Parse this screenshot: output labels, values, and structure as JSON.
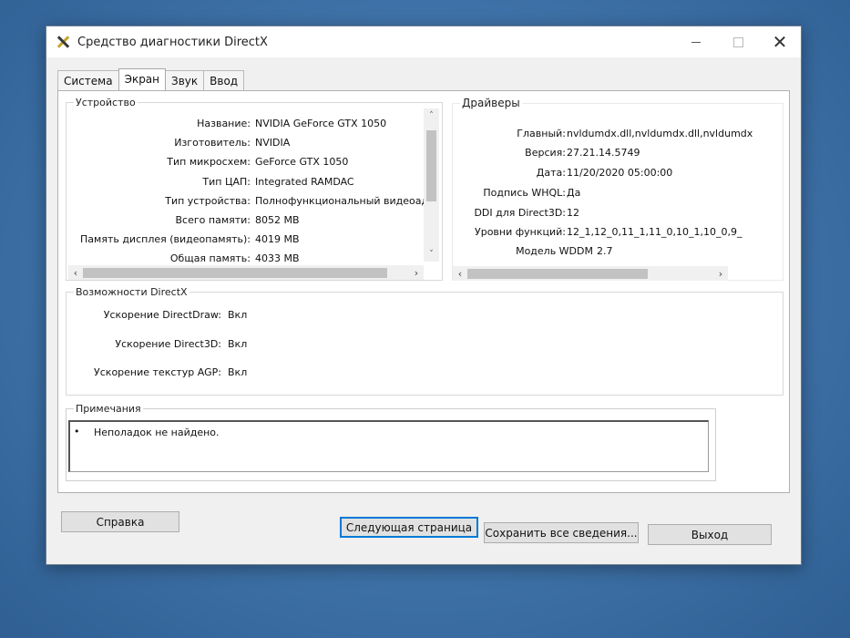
{
  "window": {
    "title": "Средство диагностики DirectX",
    "close_glyph": "✕"
  },
  "tabs": [
    {
      "label": "Система"
    },
    {
      "label": "Экран"
    },
    {
      "label": "Звук"
    },
    {
      "label": "Ввод"
    }
  ],
  "device": {
    "legend": "Устройство",
    "rows": [
      {
        "label": "Название:",
        "value": "NVIDIA GeForce GTX 1050"
      },
      {
        "label": "Изготовитель:",
        "value": "NVIDIA"
      },
      {
        "label": "Тип микросхем:",
        "value": "GeForce GTX 1050"
      },
      {
        "label": "Тип ЦАП:",
        "value": "Integrated RAMDAC"
      },
      {
        "label": "Тип устройства:",
        "value": "Полнофункциональный видеоадап"
      },
      {
        "label": "Всего памяти:",
        "value": "8052 MB"
      },
      {
        "label": "Память дисплея (видеопамять):",
        "value": "4019 MB"
      },
      {
        "label": "Общая память:",
        "value": "4033 MB"
      }
    ]
  },
  "drivers": {
    "legend": "Драйверы",
    "rows": [
      {
        "label": "Главный:",
        "value": "nvldumdx.dll,nvldumdx.dll,nvldumdx.d"
      },
      {
        "label": "Версия:",
        "value": "27.21.14.5749"
      },
      {
        "label": "Дата:",
        "value": "11/20/2020 05:00:00"
      },
      {
        "label": "Подпись WHQL:",
        "value": "Да"
      },
      {
        "label": "DDI для Direct3D:",
        "value": "12"
      },
      {
        "label": "Уровни функций:",
        "value": "12_1,12_0,11_1,11_0,10_1,10_0,9_"
      },
      {
        "label": "Модель WDDM",
        "value": "2.7"
      }
    ]
  },
  "directx": {
    "legend": "Возможности DirectX",
    "rows": [
      {
        "label": "Ускорение DirectDraw:",
        "value": "Вкл"
      },
      {
        "label": "Ускорение Direct3D:",
        "value": "Вкл"
      },
      {
        "label": "Ускорение текстур AGP:",
        "value": "Вкл"
      }
    ]
  },
  "notes": {
    "legend": "Примечания",
    "bullet": "•",
    "text": "Неполадок не найдено."
  },
  "buttons": {
    "help": "Справка",
    "next_page": "Следующая страница",
    "save_all": "Сохранить все сведения...",
    "exit": "Выход"
  },
  "scroll_glyphs": {
    "up": "˄",
    "down": "˅",
    "left": "‹",
    "right": "›"
  }
}
